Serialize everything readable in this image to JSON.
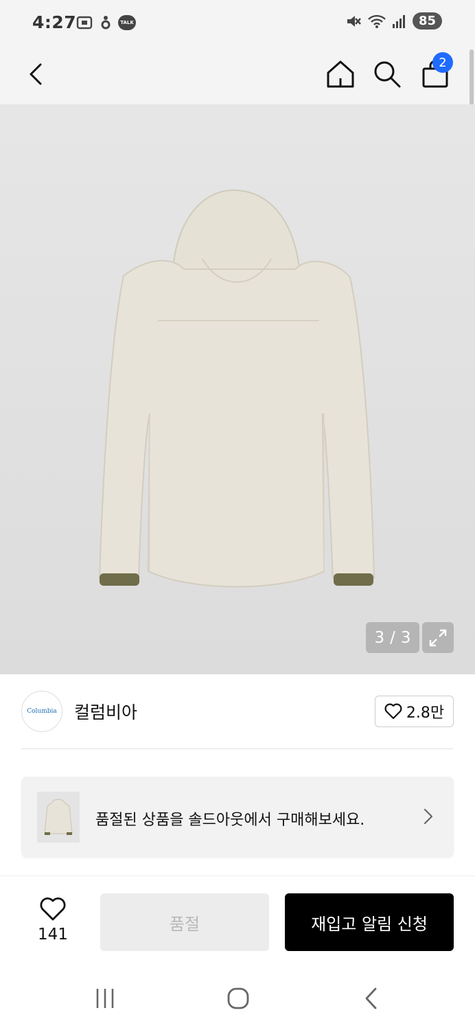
{
  "status_bar": {
    "time": "4:27",
    "battery": "85",
    "left_icons": [
      "screenshot-icon",
      "app-icon",
      "talk-icon"
    ],
    "talk_badge": "TALK",
    "right_icons": [
      "mute-icon",
      "wifi-icon",
      "signal-icon"
    ]
  },
  "nav": {
    "cart_count": "2",
    "icons": [
      "back-icon",
      "home-icon",
      "search-icon",
      "bag-icon"
    ]
  },
  "gallery": {
    "current": "3",
    "separator": "/",
    "total": "3"
  },
  "brand": {
    "logo_text": "Columbia",
    "name": "컬럼비아",
    "likes": "2.8만"
  },
  "banner": {
    "text": "품절된 상품을 솔드아웃에서 구매해보세요."
  },
  "actions": {
    "wish_count": "141",
    "soldout_label": "품절",
    "restock_label": "재입고 알림 신청"
  },
  "colors": {
    "accent": "#1f6bff",
    "primary_button": "#000000",
    "disabled_button": "#ececec"
  }
}
